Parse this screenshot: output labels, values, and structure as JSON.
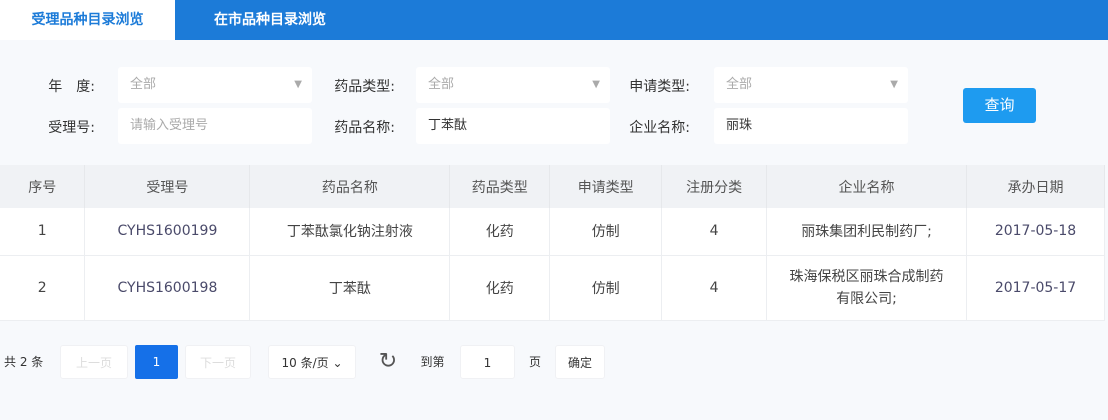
{
  "tabs": [
    {
      "label": "受理品种目录浏览",
      "active": true
    },
    {
      "label": "在市品种目录浏览",
      "active": false
    }
  ],
  "filters": {
    "year": {
      "label": "年　度:",
      "value": "全部"
    },
    "drug_type": {
      "label": "药品类型:",
      "value": "全部"
    },
    "apply_type": {
      "label": "申请类型:",
      "value": "全部"
    },
    "accept_no": {
      "label": "受理号:",
      "placeholder": "请输入受理号",
      "value": ""
    },
    "drug_name": {
      "label": "药品名称:",
      "value": "丁苯酞"
    },
    "company": {
      "label": "企业名称:",
      "value": "丽珠"
    },
    "query_button": "查询"
  },
  "table": {
    "headers": [
      "序号",
      "受理号",
      "药品名称",
      "药品类型",
      "申请类型",
      "注册分类",
      "企业名称",
      "承办日期"
    ],
    "rows": [
      [
        "1",
        "CYHS1600199",
        "丁苯酞氯化钠注射液",
        "化药",
        "仿制",
        "4",
        "丽珠集团利民制药厂;",
        "2017-05-18"
      ],
      [
        "2",
        "CYHS1600198",
        "丁苯酞",
        "化药",
        "仿制",
        "4",
        "珠海保税区丽珠合成制药有限公司;",
        "2017-05-17"
      ]
    ]
  },
  "pagination": {
    "total": "共 2 条",
    "prev": "上一页",
    "current": "1",
    "next": "下一页",
    "page_size": "10 条/页",
    "goto_label": "到第",
    "goto_value": "1",
    "page_unit": "页",
    "confirm": "确定"
  },
  "colors": {
    "accent": "#1c7bd8",
    "button": "#1e9bf0"
  }
}
